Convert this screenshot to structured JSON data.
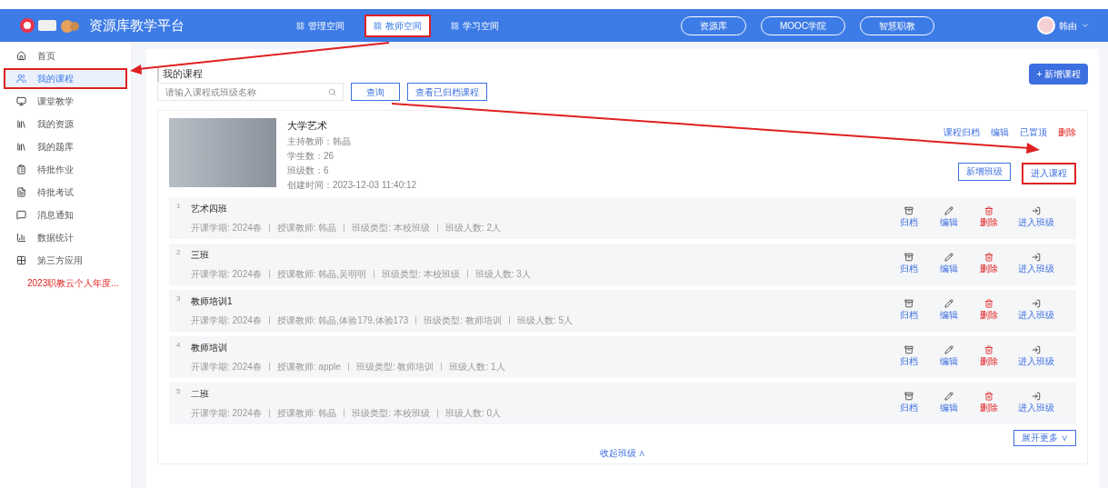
{
  "header": {
    "platform_name": "资源库教学平台",
    "spaces": [
      {
        "label": "管理空间",
        "selected": false,
        "annotated": false
      },
      {
        "label": "教师空间",
        "selected": true,
        "annotated": true
      },
      {
        "label": "学习空间",
        "selected": false,
        "annotated": false
      }
    ],
    "links": [
      "资源库",
      "MOOC学院",
      "智慧职教"
    ],
    "user": "韩由"
  },
  "sidebar": {
    "items": [
      {
        "label": "首页",
        "selected": false,
        "annotated": false,
        "kind": "home"
      },
      {
        "label": "我的课程",
        "selected": true,
        "annotated": true,
        "kind": "course"
      },
      {
        "label": "课堂教学",
        "selected": false,
        "annotated": false,
        "kind": "class"
      },
      {
        "label": "我的资源",
        "selected": false,
        "annotated": false,
        "kind": "resource"
      },
      {
        "label": "我的题库",
        "selected": false,
        "annotated": false,
        "kind": "resource"
      },
      {
        "label": "待批作业",
        "selected": false,
        "annotated": false,
        "kind": "homework"
      },
      {
        "label": "待批考试",
        "selected": false,
        "annotated": false,
        "kind": "exam"
      },
      {
        "label": "消息通知",
        "selected": false,
        "annotated": false,
        "kind": "message"
      },
      {
        "label": "数据统计",
        "selected": false,
        "annotated": false,
        "kind": "stats"
      },
      {
        "label": "第三方应用",
        "selected": false,
        "annotated": false,
        "kind": "apps"
      },
      {
        "label": "2023职教云个人年度...",
        "selected": false,
        "annotated": false,
        "kind": "report"
      }
    ]
  },
  "page_title": "我的课程",
  "search": {
    "placeholder": "请输入课程或班级名称"
  },
  "buttons": {
    "query": "查询",
    "archived": "查看已归档课程",
    "new_course": "+ 新增课程"
  },
  "course": {
    "title": "大学艺术",
    "info": [
      "主持教师：韩晶",
      "学生数：26",
      "班级数：6",
      "创建时间：2023-12-03 11:40:12"
    ],
    "links": [
      {
        "label": "课程归档",
        "kind": "normal"
      },
      {
        "label": "编辑",
        "kind": "normal"
      },
      {
        "label": "已置顶",
        "kind": "normal"
      },
      {
        "label": "删除",
        "kind": "danger"
      }
    ],
    "add_class": "新增班级",
    "enter": {
      "label": "进入课程",
      "annotated": true
    }
  },
  "classes": [
    {
      "index": "1",
      "name": "艺术四班",
      "meta": [
        "开课学期: 2024春",
        "授课教师: 韩晶",
        "班级类型: 本校班级",
        "班级人数: 2人"
      ],
      "actions": [
        {
          "label": "归档",
          "kind": "archive"
        },
        {
          "label": "编辑",
          "kind": "edit"
        },
        {
          "label": "删除",
          "kind": "delete"
        },
        {
          "label": "进入班级",
          "kind": "enter"
        }
      ]
    },
    {
      "index": "2",
      "name": "三班",
      "meta": [
        "开课学期: 2024春",
        "授课教师: 韩晶,吴明明",
        "班级类型: 本校班级",
        "班级人数: 3人"
      ],
      "actions": [
        {
          "label": "归档",
          "kind": "archive"
        },
        {
          "label": "编辑",
          "kind": "edit"
        },
        {
          "label": "删除",
          "kind": "delete"
        },
        {
          "label": "进入班级",
          "kind": "enter"
        }
      ]
    },
    {
      "index": "3",
      "name": "教师培训1",
      "meta": [
        "开课学期: 2024春",
        "授课教师: 韩晶,体验179,体验173",
        "班级类型: 教师培训",
        "班级人数: 5人"
      ],
      "actions": [
        {
          "label": "归档",
          "kind": "archive"
        },
        {
          "label": "编辑",
          "kind": "edit"
        },
        {
          "label": "删除",
          "kind": "delete"
        },
        {
          "label": "进入班级",
          "kind": "enter"
        }
      ]
    },
    {
      "index": "4",
      "name": "教师培训",
      "meta": [
        "开课学期: 2024春",
        "授课教师: apple",
        "班级类型: 教师培训",
        "班级人数: 1人"
      ],
      "actions": [
        {
          "label": "归档",
          "kind": "archive"
        },
        {
          "label": "编辑",
          "kind": "edit"
        },
        {
          "label": "删除",
          "kind": "delete"
        },
        {
          "label": "进入班级",
          "kind": "enter"
        }
      ]
    },
    {
      "index": "5",
      "name": "二班",
      "meta": [
        "开课学期: 2024春",
        "授课教师: 韩晶",
        "班级类型: 本校班级",
        "班级人数: 0人"
      ],
      "actions": [
        {
          "label": "归档",
          "kind": "archive"
        },
        {
          "label": "编辑",
          "kind": "edit"
        },
        {
          "label": "删除",
          "kind": "delete"
        },
        {
          "label": "进入班级",
          "kind": "enter"
        }
      ]
    }
  ],
  "more_button": "展开更多 ∨",
  "collapse_link": "收起班级 ∧"
}
